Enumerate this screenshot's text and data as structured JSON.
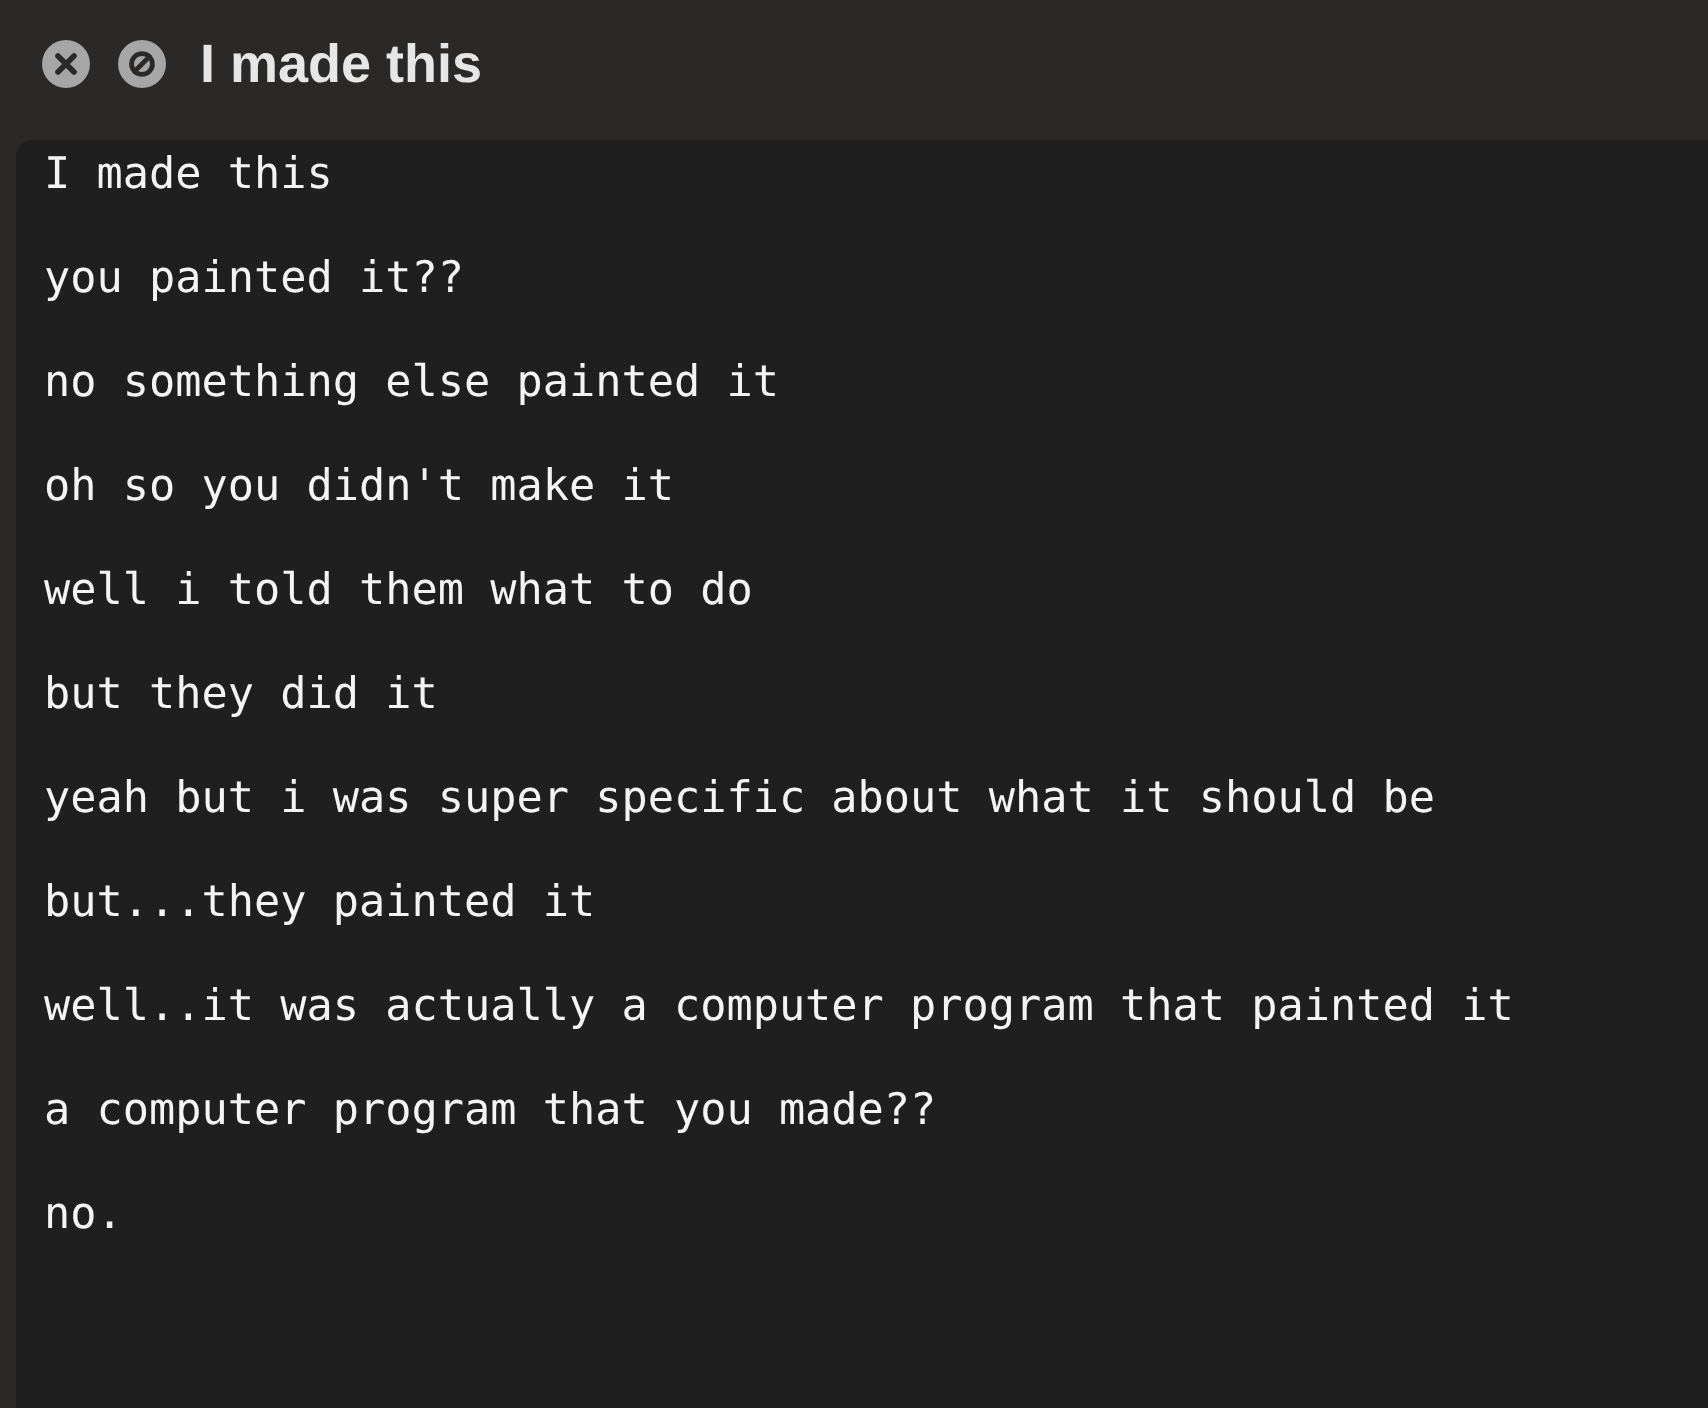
{
  "window": {
    "title": "I made this",
    "buttons": [
      {
        "kind": "close"
      },
      {
        "kind": "block"
      }
    ]
  },
  "lines": [
    "I made this",
    "you painted it??",
    "no something else painted it",
    "oh so you didn't make it",
    "well i told them what to do",
    "but they did it",
    "yeah but i was super specific about what it should be",
    "but...they painted it",
    "well..it was actually a computer program that painted it",
    "a computer program that you made??",
    "no."
  ]
}
